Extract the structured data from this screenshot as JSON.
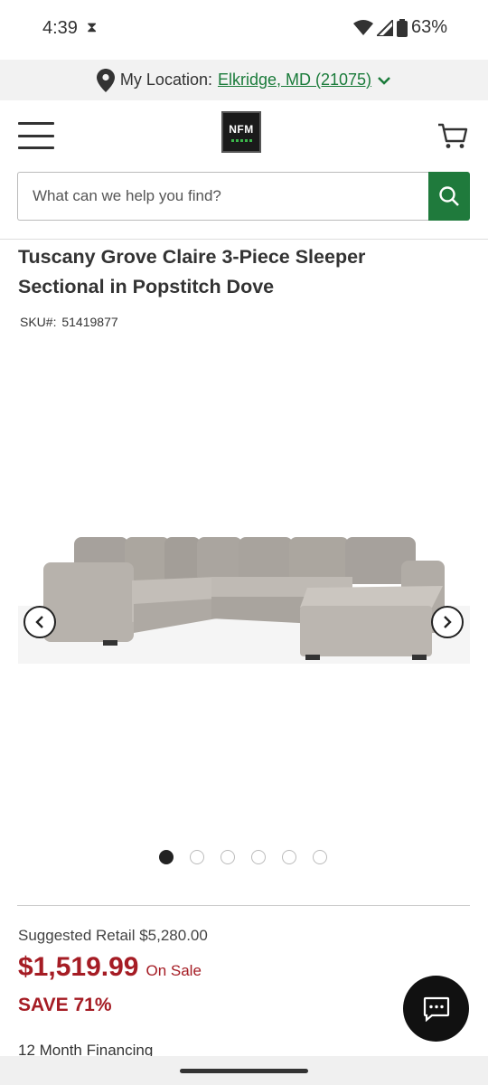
{
  "status": {
    "time": "4:39",
    "battery": "63%"
  },
  "location": {
    "label": "My Location:",
    "value": "Elkridge, MD (21075)"
  },
  "header": {
    "logo_text": "NFM"
  },
  "search": {
    "placeholder": "What can we help you find?"
  },
  "product": {
    "title": "Tuscany Grove Claire 3-Piece Sleeper Sectional in Popstitch Dove",
    "sku_label": "SKU#:",
    "sku_value": "51419877",
    "image_count": 6,
    "active_image": 1
  },
  "pricing": {
    "suggested_retail": "Suggested Retail $5,280.00",
    "price": "$1,519.99",
    "sale_label": "On Sale",
    "savings": "SAVE 71%",
    "financing": "12 Month Financing"
  },
  "colors": {
    "accent_green": "#1f7a3c",
    "link_green": "#1a7b3a",
    "sale_red": "#a51c24"
  },
  "icons": {
    "location": "map-pin-icon",
    "menu": "hamburger-menu-icon",
    "cart": "shopping-cart-icon",
    "search": "search-icon",
    "chat": "chat-icon"
  }
}
